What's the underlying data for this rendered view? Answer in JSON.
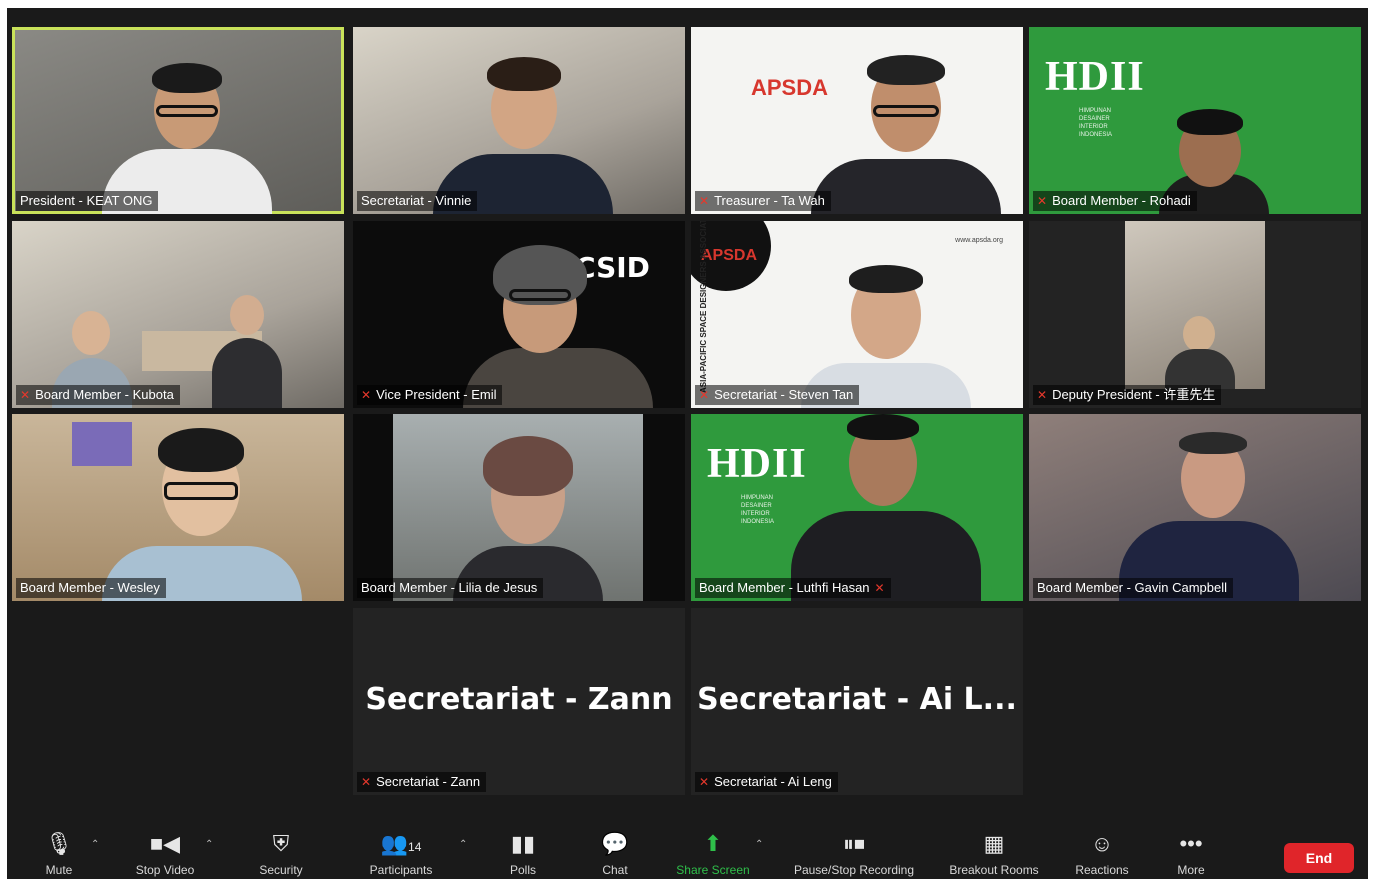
{
  "participants": [
    {
      "name": "President - KEAT ONG"
    },
    {
      "name": "Secretariat - Vinnie"
    },
    {
      "name": "Treasurer - Ta Wah"
    },
    {
      "name": "Board Member - Rohadi"
    },
    {
      "name": "Board Member - Kubota"
    },
    {
      "name": "Vice President - Emil"
    },
    {
      "name": "Secretariat - Steven Tan"
    },
    {
      "name": "Deputy President - 许重先生"
    },
    {
      "name": "Board Member - Wesley"
    },
    {
      "name": "Board Member - Lilia de Jesus"
    },
    {
      "name": "Board Member - Luthfi Hasan"
    },
    {
      "name": "Board Member - Gavin Campbell"
    },
    {
      "name": "Secretariat - Zann",
      "display": "Secretariat - Zann"
    },
    {
      "name": "Secretariat - Ai Leng",
      "display": "Secretariat - Ai L..."
    }
  ],
  "backgrounds": {
    "apsda": "APSDA",
    "hdii": "HDII",
    "hdii_sub": "HIMPUNAN DESAINER INTERIOR INDONESIA",
    "csid": "CSID",
    "apsda_url": "www.apsda.org",
    "apsda_vertical": "ASIA-PACIFIC SPACE DESIGNERS ASSOCIATION"
  },
  "toolbar": {
    "mute": "Mute",
    "stop_video": "Stop Video",
    "security": "Security",
    "participants": "Participants",
    "participants_count": "14",
    "polls": "Polls",
    "chat": "Chat",
    "share_screen": "Share Screen",
    "recording": "Pause/Stop Recording",
    "breakout": "Breakout Rooms",
    "reactions": "Reactions",
    "more": "More",
    "end": "End"
  },
  "colors": {
    "active_speaker": "#c9e25a",
    "share_green": "#2fbf4a",
    "end_red": "#e0252a",
    "hdii_green": "#2f9a3d"
  }
}
